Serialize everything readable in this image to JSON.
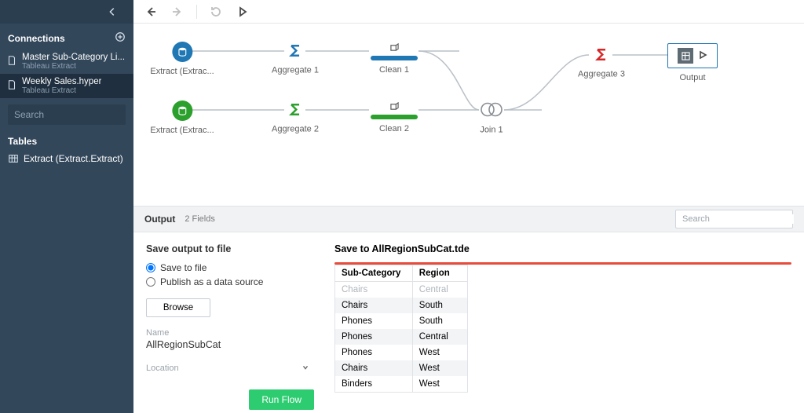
{
  "sidebar": {
    "connections_label": "Connections",
    "items": [
      {
        "name": "Master Sub-Category Li...",
        "sub": "Tableau Extract"
      },
      {
        "name": "Weekly Sales.hyper",
        "sub": "Tableau Extract"
      }
    ],
    "search_placeholder": "Search",
    "tables_label": "Tables",
    "table_name": "Extract (Extract.Extract)"
  },
  "flow": {
    "nodes": {
      "ext1": "Extract (Extrac...",
      "agg1": "Aggregate 1",
      "clean1": "Clean 1",
      "ext2": "Extract (Extrac...",
      "agg2": "Aggregate 2",
      "clean2": "Clean 2",
      "join1": "Join 1",
      "agg3": "Aggregate 3",
      "out": "Output"
    }
  },
  "outbar": {
    "title": "Output",
    "fields": "2 Fields",
    "search_placeholder": "Search"
  },
  "left": {
    "heading": "Save output to file",
    "radio_file": "Save to file",
    "radio_pub": "Publish as a data source",
    "browse": "Browse",
    "name_label": "Name",
    "name_value": "AllRegionSubCat",
    "loc_label": "Location",
    "run": "Run Flow"
  },
  "right": {
    "heading": "Save to AllRegionSubCat.tde",
    "col1": "Sub-Category",
    "col2": "Region",
    "rows": [
      {
        "c1": "Chairs",
        "c2": "Central",
        "faded": true
      },
      {
        "c1": "Chairs",
        "c2": "South"
      },
      {
        "c1": "Phones",
        "c2": "South"
      },
      {
        "c1": "Phones",
        "c2": "Central"
      },
      {
        "c1": "Phones",
        "c2": "West"
      },
      {
        "c1": "Chairs",
        "c2": "West"
      },
      {
        "c1": "Binders",
        "c2": "West"
      }
    ]
  }
}
